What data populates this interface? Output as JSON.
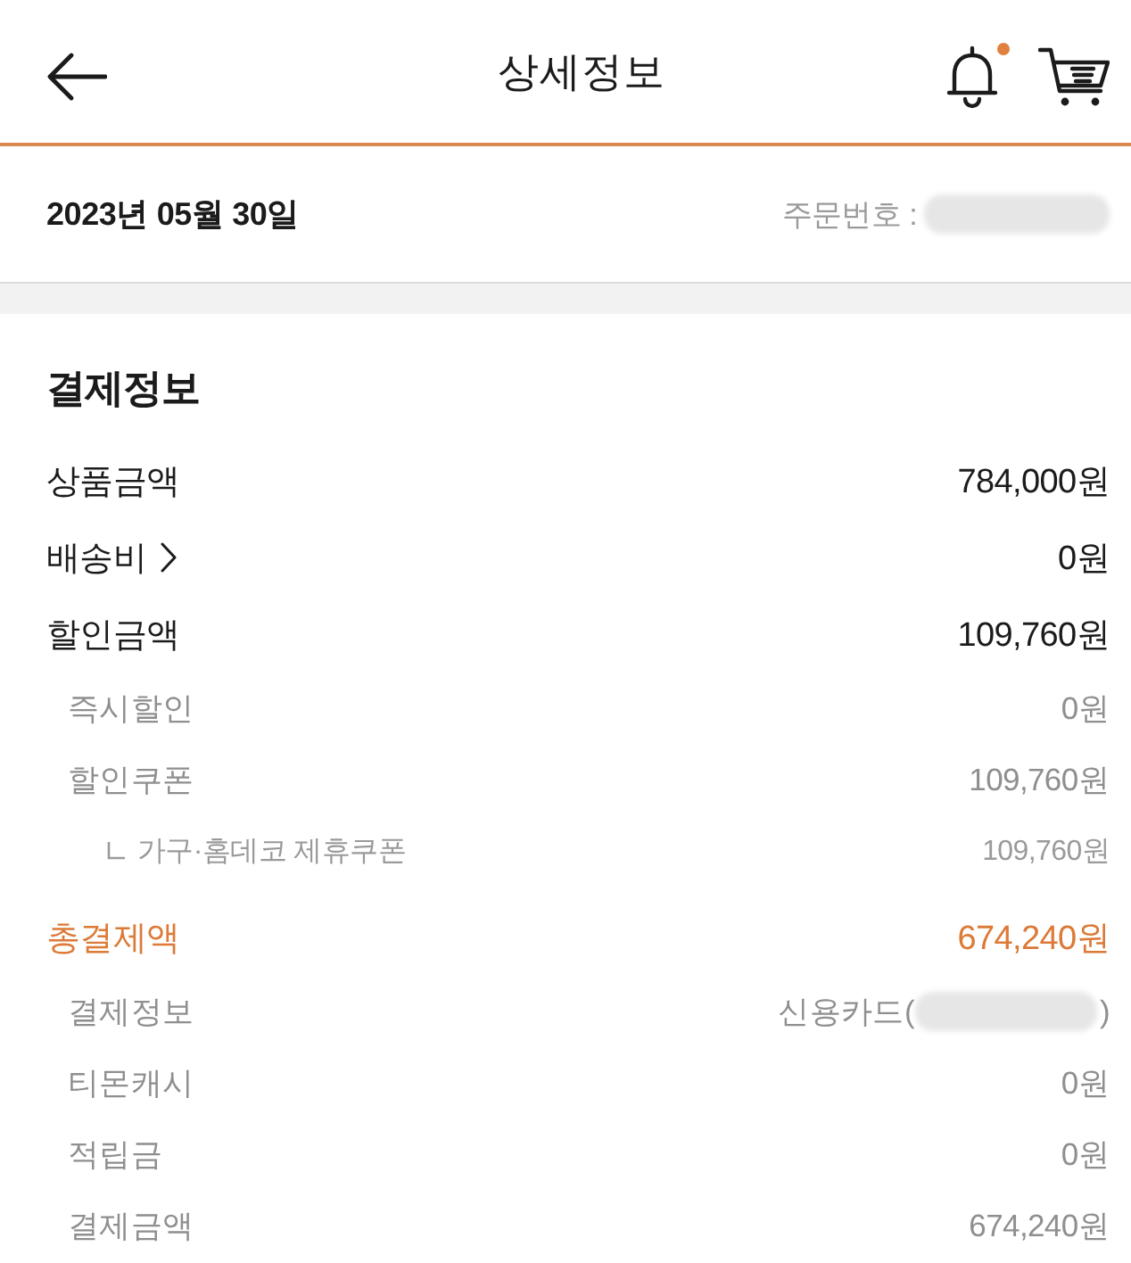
{
  "header": {
    "title": "상세정보",
    "has_notification": true
  },
  "order": {
    "date": "2023년 05월 30일",
    "number_label": "주문번호 :",
    "number_redacted": true
  },
  "payment": {
    "title": "결제정보",
    "rows": [
      {
        "kind": "main",
        "label": "상품금액",
        "value": "784,000원",
        "link": false
      },
      {
        "kind": "main",
        "label": "배송비",
        "value": "0원",
        "link": true
      },
      {
        "kind": "main",
        "label": "할인금액",
        "value": "109,760원",
        "link": false
      },
      {
        "kind": "sub",
        "label": "즉시할인",
        "value": "0원",
        "link": false
      },
      {
        "kind": "sub",
        "label": "할인쿠폰",
        "value": "109,760원",
        "link": false
      },
      {
        "kind": "detail",
        "label": "가구·홈데코 제휴쿠폰",
        "value": "109,760원",
        "link": false
      },
      {
        "kind": "total",
        "label": "총결제액",
        "value": "674,240원",
        "link": false
      },
      {
        "kind": "sub",
        "label": "결제정보",
        "value": "신용카드(",
        "redacted": true,
        "value_end": ")",
        "link": false
      },
      {
        "kind": "sub",
        "label": "티몬캐시",
        "value": "0원",
        "link": false
      },
      {
        "kind": "sub",
        "label": "적립금",
        "value": "0원",
        "link": false
      },
      {
        "kind": "sub",
        "label": "결제금액",
        "value": "674,240원",
        "link": false
      }
    ]
  }
}
